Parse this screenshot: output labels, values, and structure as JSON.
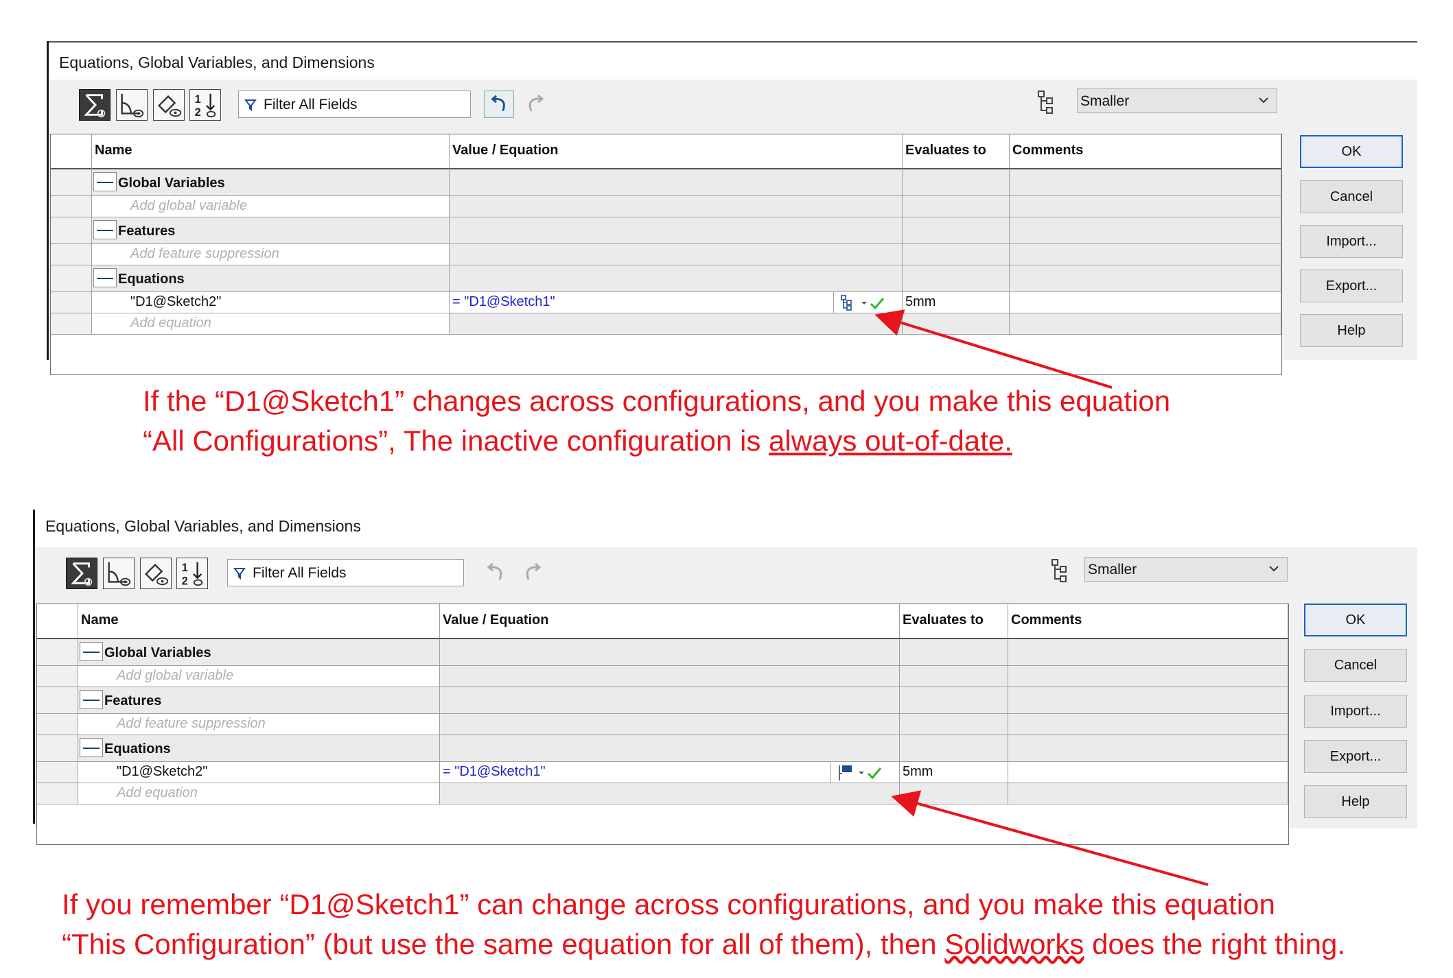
{
  "dialog": {
    "title": "Equations, Global Variables, and Dimensions",
    "filter_placeholder": "Filter All Fields",
    "view_select": "Smaller",
    "columns": {
      "name": "Name",
      "value": "Value / Equation",
      "evaluates": "Evaluates to",
      "comments": "Comments"
    },
    "sections": {
      "global": "Global Variables",
      "features": "Features",
      "equations": "Equations"
    },
    "placeholders": {
      "global": "Add global variable",
      "features": "Add feature suppression",
      "equation": "Add equation"
    },
    "equation_row": {
      "name": "\"D1@Sketch2\"",
      "value": "= \"D1@Sketch1\"",
      "evaluates": "5mm"
    },
    "buttons": {
      "ok": "OK",
      "cancel": "Cancel",
      "import": "Import...",
      "export": "Export...",
      "help": "Help"
    },
    "tool_icons": [
      "sum-icon",
      "dimension-view-icon",
      "edit-eye-icon",
      "ordered-view-icon"
    ],
    "config_icons": {
      "top": "all-configurations-icon",
      "bottom": "this-configuration-icon"
    }
  },
  "annotations": {
    "top_line1": "If the “D1@Sketch1” changes across configurations, and you make this equation",
    "top_line2_pre": "“All Configurations”, The inactive configuration is ",
    "top_line2_ul": "always out-of-date.",
    "bottom_line1": "If you remember “D1@Sketch1” can change across configurations, and you make this equation",
    "bottom_line2_pre": "“This Configuration” (but use the same equation for all of them), then ",
    "bottom_line2_wavy": "Solidworks",
    "bottom_line2_post": " does the right thing."
  },
  "colors": {
    "annotation": "#e8141b",
    "ok_border": "#1565c0",
    "equation_text": "#2222cc",
    "check": "#2db82d"
  }
}
